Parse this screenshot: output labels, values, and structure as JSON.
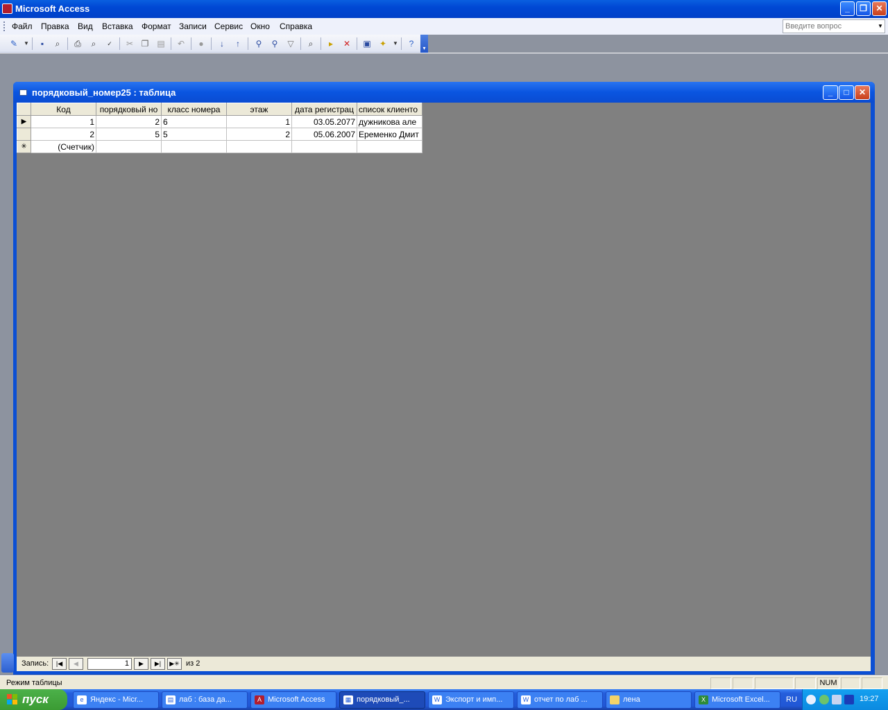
{
  "app": {
    "title": "Microsoft Access",
    "minimize": "_",
    "restore": "❐",
    "close": "✕"
  },
  "menu": {
    "items": [
      "Файл",
      "Правка",
      "Вид",
      "Вставка",
      "Формат",
      "Записи",
      "Сервис",
      "Окно",
      "Справка"
    ],
    "ask_placeholder": "Введите вопрос"
  },
  "toolbar": {
    "icons": [
      "design-view-icon",
      "save-icon",
      "search-icon",
      "print-icon",
      "print-preview-icon",
      "spelling-icon",
      "cut-icon",
      "copy-icon",
      "paste-icon",
      "undo-icon",
      "hyperlink-icon",
      "sort-ascending-icon",
      "sort-descending-icon",
      "filter-by-selection-icon",
      "filter-by-form-icon",
      "apply-filter-icon",
      "find-icon",
      "new-record-icon",
      "delete-record-icon",
      "database-window-icon",
      "new-object-icon",
      "help-icon"
    ]
  },
  "child_window": {
    "title": "порядковый_номер25 : таблица"
  },
  "datasheet": {
    "columns": [
      "Код",
      "порядковый но",
      "класс номера",
      "этаж",
      "дата регистрац",
      "список клиенто"
    ],
    "rows": [
      [
        "1",
        "2",
        "6",
        "1",
        "03.05.2077",
        "дужникова але"
      ],
      [
        "2",
        "5",
        "5",
        "2",
        "05.06.2007",
        "Еременко Дмит"
      ]
    ],
    "new_row_placeholder": "(Счетчик)",
    "current_marker": "▶",
    "new_marker": "✳"
  },
  "record_nav": {
    "label": "Запись:",
    "current": "1",
    "of_text": "из  2"
  },
  "status": {
    "text": "Режим таблицы",
    "num": "NUM"
  },
  "taskbar": {
    "start": "пуск",
    "tasks": [
      {
        "label": "Яндекс - Micr...",
        "icon": "ie-icon"
      },
      {
        "label": "лаб : база да...",
        "icon": "database-icon"
      },
      {
        "label": "Microsoft Access",
        "icon": "access-icon"
      },
      {
        "label": "порядковый_...",
        "icon": "table-icon"
      },
      {
        "label": "Экспорт и имп...",
        "icon": "word-icon"
      },
      {
        "label": "отчет по лаб ...",
        "icon": "word-icon"
      },
      {
        "label": "лена",
        "icon": "folder-icon"
      },
      {
        "label": "Microsoft Excel...",
        "icon": "excel-icon"
      }
    ],
    "lang": "RU",
    "clock": "19:27"
  }
}
